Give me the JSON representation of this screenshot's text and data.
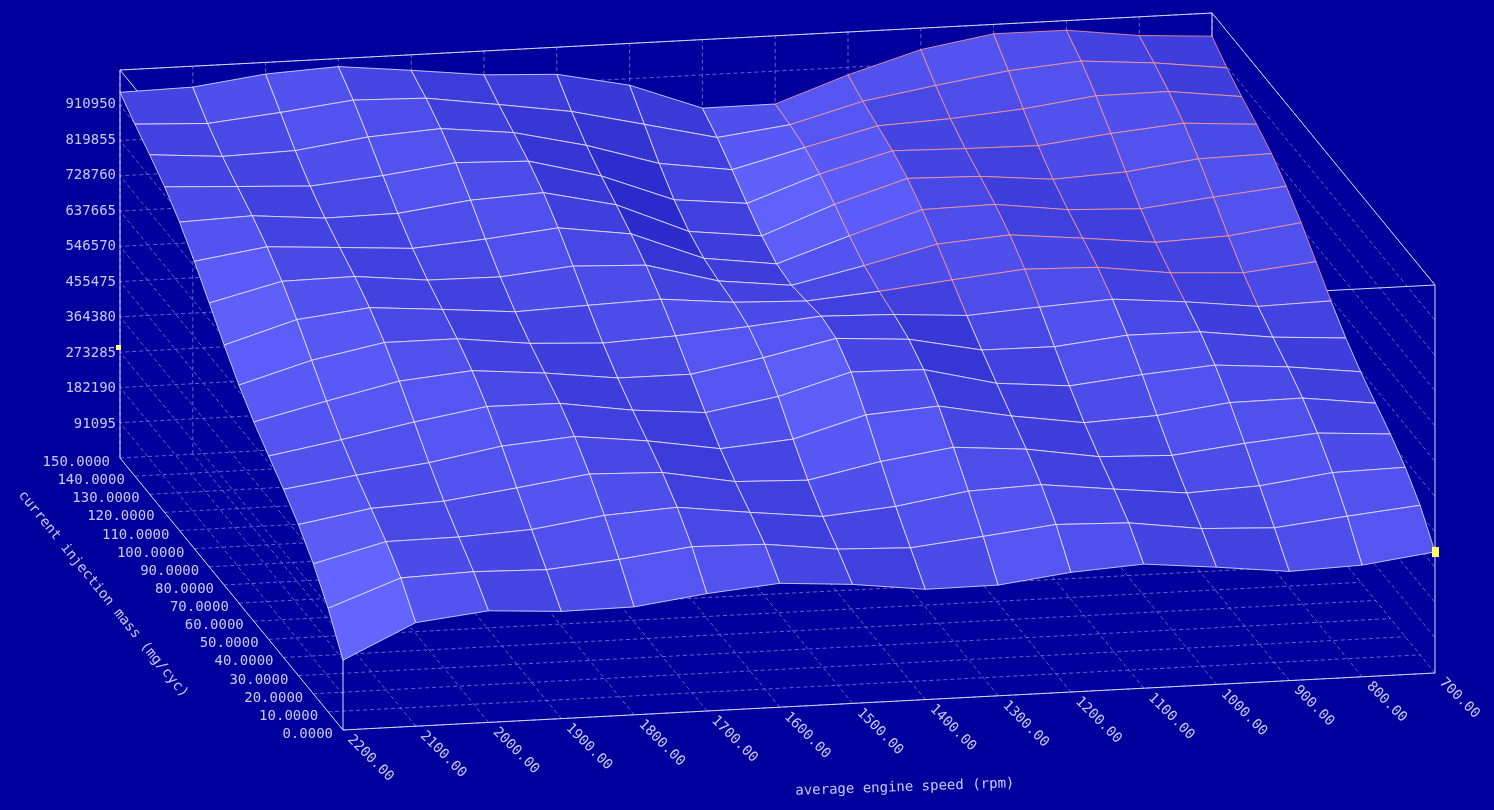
{
  "chart": {
    "z_axis": {
      "tick_labels": [
        "910950",
        "819855",
        "728760",
        "637665",
        "546570",
        "455475",
        "364380",
        "273285",
        "182190",
        "91095"
      ]
    },
    "mass_axis": {
      "title": "current injection mass (mg/cyc)",
      "tick_labels": [
        "150.0000",
        "140.0000",
        "130.0000",
        "120.0000",
        "110.0000",
        "100.0000",
        "90.0000",
        "80.0000",
        "70.0000",
        "60.0000",
        "50.0000",
        "40.0000",
        "30.0000",
        "20.0000",
        "10.0000",
        "0.0000"
      ]
    },
    "rpm_axis": {
      "title": "average engine speed (rpm)",
      "tick_labels": [
        "2200.00",
        "2100.00",
        "2000.00",
        "1900.00",
        "1800.00",
        "1700.00",
        "1600.00",
        "1500.00",
        "1400.00",
        "1300.00",
        "1200.00",
        "1100.00",
        "1000.00",
        "900.00",
        "800.00",
        "700.00"
      ]
    }
  }
}
